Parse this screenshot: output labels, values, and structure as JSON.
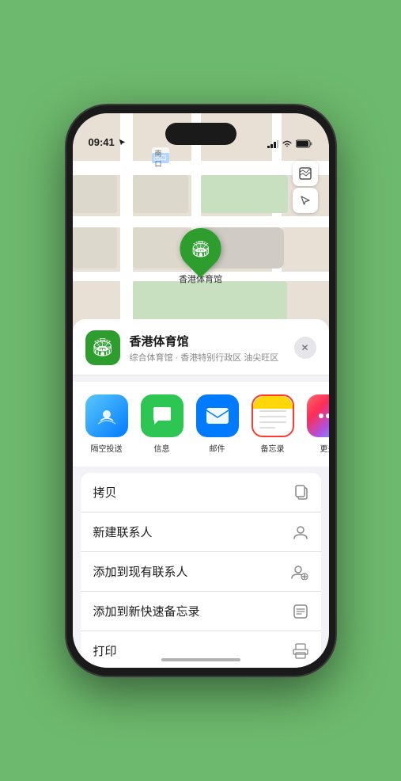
{
  "statusBar": {
    "time": "09:41",
    "locationArrow": true
  },
  "map": {
    "labelNorthGate": "南口",
    "venueNamePin": "香港体育馆"
  },
  "mapControls": {
    "mapTypeIcon": "🗺",
    "locationIcon": "↗"
  },
  "venue": {
    "name": "香港体育馆",
    "subtitle": "综合体育馆 · 香港特别行政区 油尖旺区",
    "icon": "🏟"
  },
  "shareItems": [
    {
      "id": "airdrop",
      "label": "隔空投送",
      "iconClass": "share-airdrop",
      "icon": "📡"
    },
    {
      "id": "messages",
      "label": "信息",
      "iconClass": "share-messages",
      "icon": "💬"
    },
    {
      "id": "mail",
      "label": "邮件",
      "iconClass": "share-mail",
      "icon": "✉️"
    },
    {
      "id": "notes",
      "label": "备忘录",
      "iconClass": "share-notes",
      "selected": true
    },
    {
      "id": "more",
      "label": "更多",
      "iconClass": "share-more",
      "icon": "⋯"
    }
  ],
  "actions": [
    {
      "id": "copy",
      "label": "拷贝",
      "icon": "⎘"
    },
    {
      "id": "new-contact",
      "label": "新建联系人",
      "icon": "👤"
    },
    {
      "id": "add-existing",
      "label": "添加到现有联系人",
      "icon": "➕👤"
    },
    {
      "id": "add-notes",
      "label": "添加到新快速备忘录",
      "icon": "🗒"
    },
    {
      "id": "print",
      "label": "打印",
      "icon": "🖨"
    }
  ]
}
